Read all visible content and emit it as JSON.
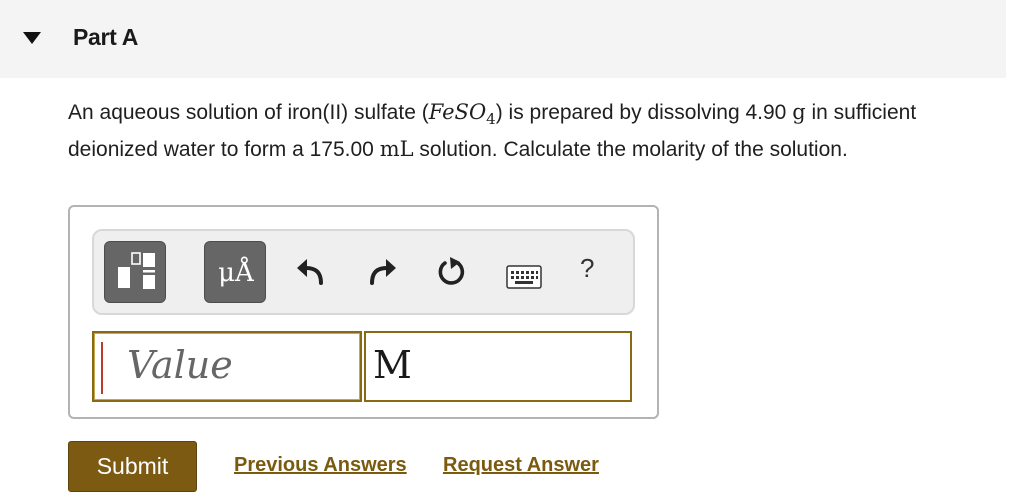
{
  "part": {
    "title": "Part A"
  },
  "question": {
    "text_1": "An aqueous solution of iron(II) sulfate (",
    "formula": "FeSO",
    "formula_subscript": "4",
    "text_2": ") is prepared by dissolving 4.90 ",
    "mass_unit": "g",
    "text_3": " in sufficient deionized water to form a 175.00 ",
    "volume_unit": "mL",
    "text_4": " solution. Calculate the molarity of the solution."
  },
  "toolbar": {
    "units_button_label": "μÅ",
    "help_label": "?"
  },
  "answer": {
    "value_placeholder": "Value",
    "unit_value": "M"
  },
  "actions": {
    "submit_label": "Submit",
    "previous_answers_label": "Previous Answers",
    "request_answer_label": "Request Answer"
  },
  "colors": {
    "accent": "#7d5a12",
    "link": "#7a5a0e",
    "header_bg": "#f4f4f4"
  }
}
